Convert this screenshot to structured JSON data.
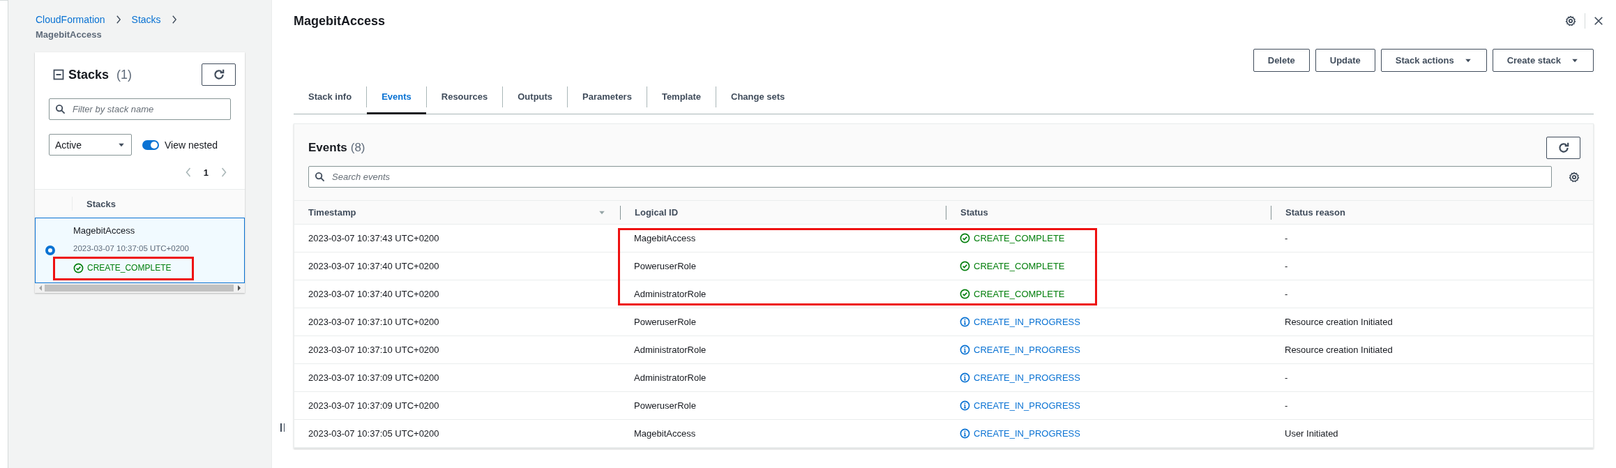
{
  "breadcrumb": {
    "links": [
      "CloudFormation",
      "Stacks"
    ],
    "current": "MagebitAccess"
  },
  "stacks_panel": {
    "title": "Stacks",
    "count": "(1)",
    "filter": {
      "placeholder": "Filter by stack name"
    },
    "status_filter": "Active",
    "view_nested": {
      "label": "View nested",
      "on": true
    },
    "pagination": {
      "page": "1",
      "prev_disabled": true,
      "next_disabled": true
    },
    "column": "Stacks",
    "items": [
      {
        "name": "MagebitAccess",
        "time": "2023-03-07 10:37:05 UTC+0200",
        "status": {
          "kind": "complete",
          "text": "CREATE_COMPLETE"
        },
        "selected": true,
        "highlighted": true
      }
    ]
  },
  "title": "MagebitAccess",
  "buttons": [
    {
      "label": "Delete",
      "dropdown": false
    },
    {
      "label": "Update",
      "dropdown": false
    },
    {
      "label": "Stack actions",
      "dropdown": true
    },
    {
      "label": "Create stack",
      "dropdown": true
    }
  ],
  "tabs": [
    {
      "label": "Stack info",
      "selected": false
    },
    {
      "label": "Events",
      "selected": true
    },
    {
      "label": "Resources",
      "selected": false
    },
    {
      "label": "Outputs",
      "selected": false
    },
    {
      "label": "Parameters",
      "selected": false
    },
    {
      "label": "Template",
      "selected": false
    },
    {
      "label": "Change sets",
      "selected": false
    }
  ],
  "events": {
    "title": "Events",
    "count": "(8)",
    "search": {
      "placeholder": "Search events"
    },
    "columns": [
      {
        "label": "Timestamp",
        "sorted": true
      },
      {
        "label": "Logical ID",
        "sorted": false
      },
      {
        "label": "Status",
        "sorted": false
      },
      {
        "label": "Status reason",
        "sorted": false
      }
    ],
    "rows": [
      {
        "timestamp": "2023-03-07 10:37:43 UTC+0200",
        "logical_id": "MagebitAccess",
        "status": {
          "kind": "complete",
          "text": "CREATE_COMPLETE"
        },
        "reason": "-",
        "highlighted": true
      },
      {
        "timestamp": "2023-03-07 10:37:40 UTC+0200",
        "logical_id": "PoweruserRole",
        "status": {
          "kind": "complete",
          "text": "CREATE_COMPLETE"
        },
        "reason": "-",
        "highlighted": true
      },
      {
        "timestamp": "2023-03-07 10:37:40 UTC+0200",
        "logical_id": "AdministratorRole",
        "status": {
          "kind": "complete",
          "text": "CREATE_COMPLETE"
        },
        "reason": "-",
        "highlighted": true
      },
      {
        "timestamp": "2023-03-07 10:37:10 UTC+0200",
        "logical_id": "PoweruserRole",
        "status": {
          "kind": "in_progress",
          "text": "CREATE_IN_PROGRESS"
        },
        "reason": "Resource creation Initiated",
        "highlighted": false
      },
      {
        "timestamp": "2023-03-07 10:37:10 UTC+0200",
        "logical_id": "AdministratorRole",
        "status": {
          "kind": "in_progress",
          "text": "CREATE_IN_PROGRESS"
        },
        "reason": "Resource creation Initiated",
        "highlighted": false
      },
      {
        "timestamp": "2023-03-07 10:37:09 UTC+0200",
        "logical_id": "AdministratorRole",
        "status": {
          "kind": "in_progress",
          "text": "CREATE_IN_PROGRESS"
        },
        "reason": "-",
        "highlighted": false
      },
      {
        "timestamp": "2023-03-07 10:37:09 UTC+0200",
        "logical_id": "PoweruserRole",
        "status": {
          "kind": "in_progress",
          "text": "CREATE_IN_PROGRESS"
        },
        "reason": "-",
        "highlighted": false
      },
      {
        "timestamp": "2023-03-07 10:37:05 UTC+0200",
        "logical_id": "MagebitAccess",
        "status": {
          "kind": "in_progress",
          "text": "CREATE_IN_PROGRESS"
        },
        "reason": "User Initiated",
        "highlighted": false
      }
    ]
  }
}
